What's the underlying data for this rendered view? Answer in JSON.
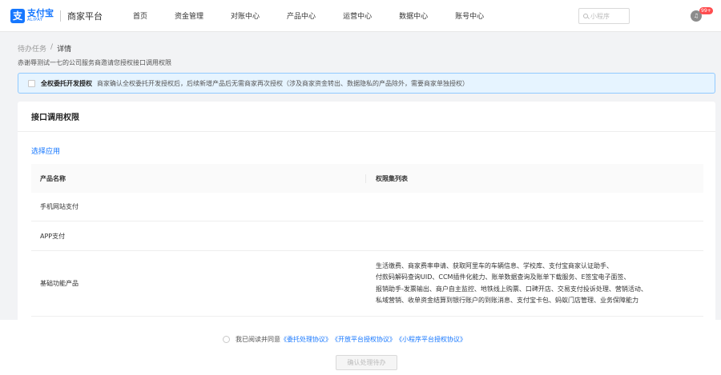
{
  "header": {
    "logo_mark": "支",
    "logo_cn": "支付宝",
    "logo_en": "ALIPAY",
    "platform": "商家平台",
    "nav": [
      "首页",
      "资金管理",
      "对账中心",
      "产品中心",
      "运营中心",
      "数据中心",
      "账号中心"
    ],
    "search_placeholder": "小程序",
    "badge": "99+"
  },
  "breadcrumb": {
    "parent": "待办任务",
    "separator": "/",
    "current": "详情"
  },
  "description": "赤谢辱测试一七的公司服务商邀请您授权接口调用权限",
  "notice": {
    "title": "全权委托开发授权",
    "text": "商家确认全权委托开发授权后，后续新增产品后无需商家再次授权（涉及商家资金转出、数据隐私的产品除外，需要商家单独授权）"
  },
  "card": {
    "title": "接口调用权限",
    "select_link": "选择应用",
    "columns": [
      "产品名称",
      "权限集列表"
    ],
    "rows": [
      {
        "name": "手机网站支付",
        "perms": []
      },
      {
        "name": "APP支付",
        "perms": []
      },
      {
        "name": "基础功能产品",
        "perms": [
          "生活缴费、商家费率申请、获取阿里车的车辆信息、学校库、支付宝商家认证助手、",
          "付款码解码查询UID、CCM插件化能力、账单数据查询及账单下载服务、E签宝电子面签、",
          "报销助手-发票输出、商户自主监控、地铁线上购票、口碑开店、交易支付投诉处理、营销活动、",
          "私域营销、收单资金结算到银行账户的到账消息、支付宝卡包、蚂蚁门店管理、业务保障能力"
        ]
      }
    ]
  },
  "footer": {
    "agree_prefix": "我已阅读并同意",
    "links": [
      "《委托处理协议》",
      "《开放平台授权协议》",
      "《小程序平台授权协议》"
    ],
    "confirm_label": "确认处理待办"
  }
}
